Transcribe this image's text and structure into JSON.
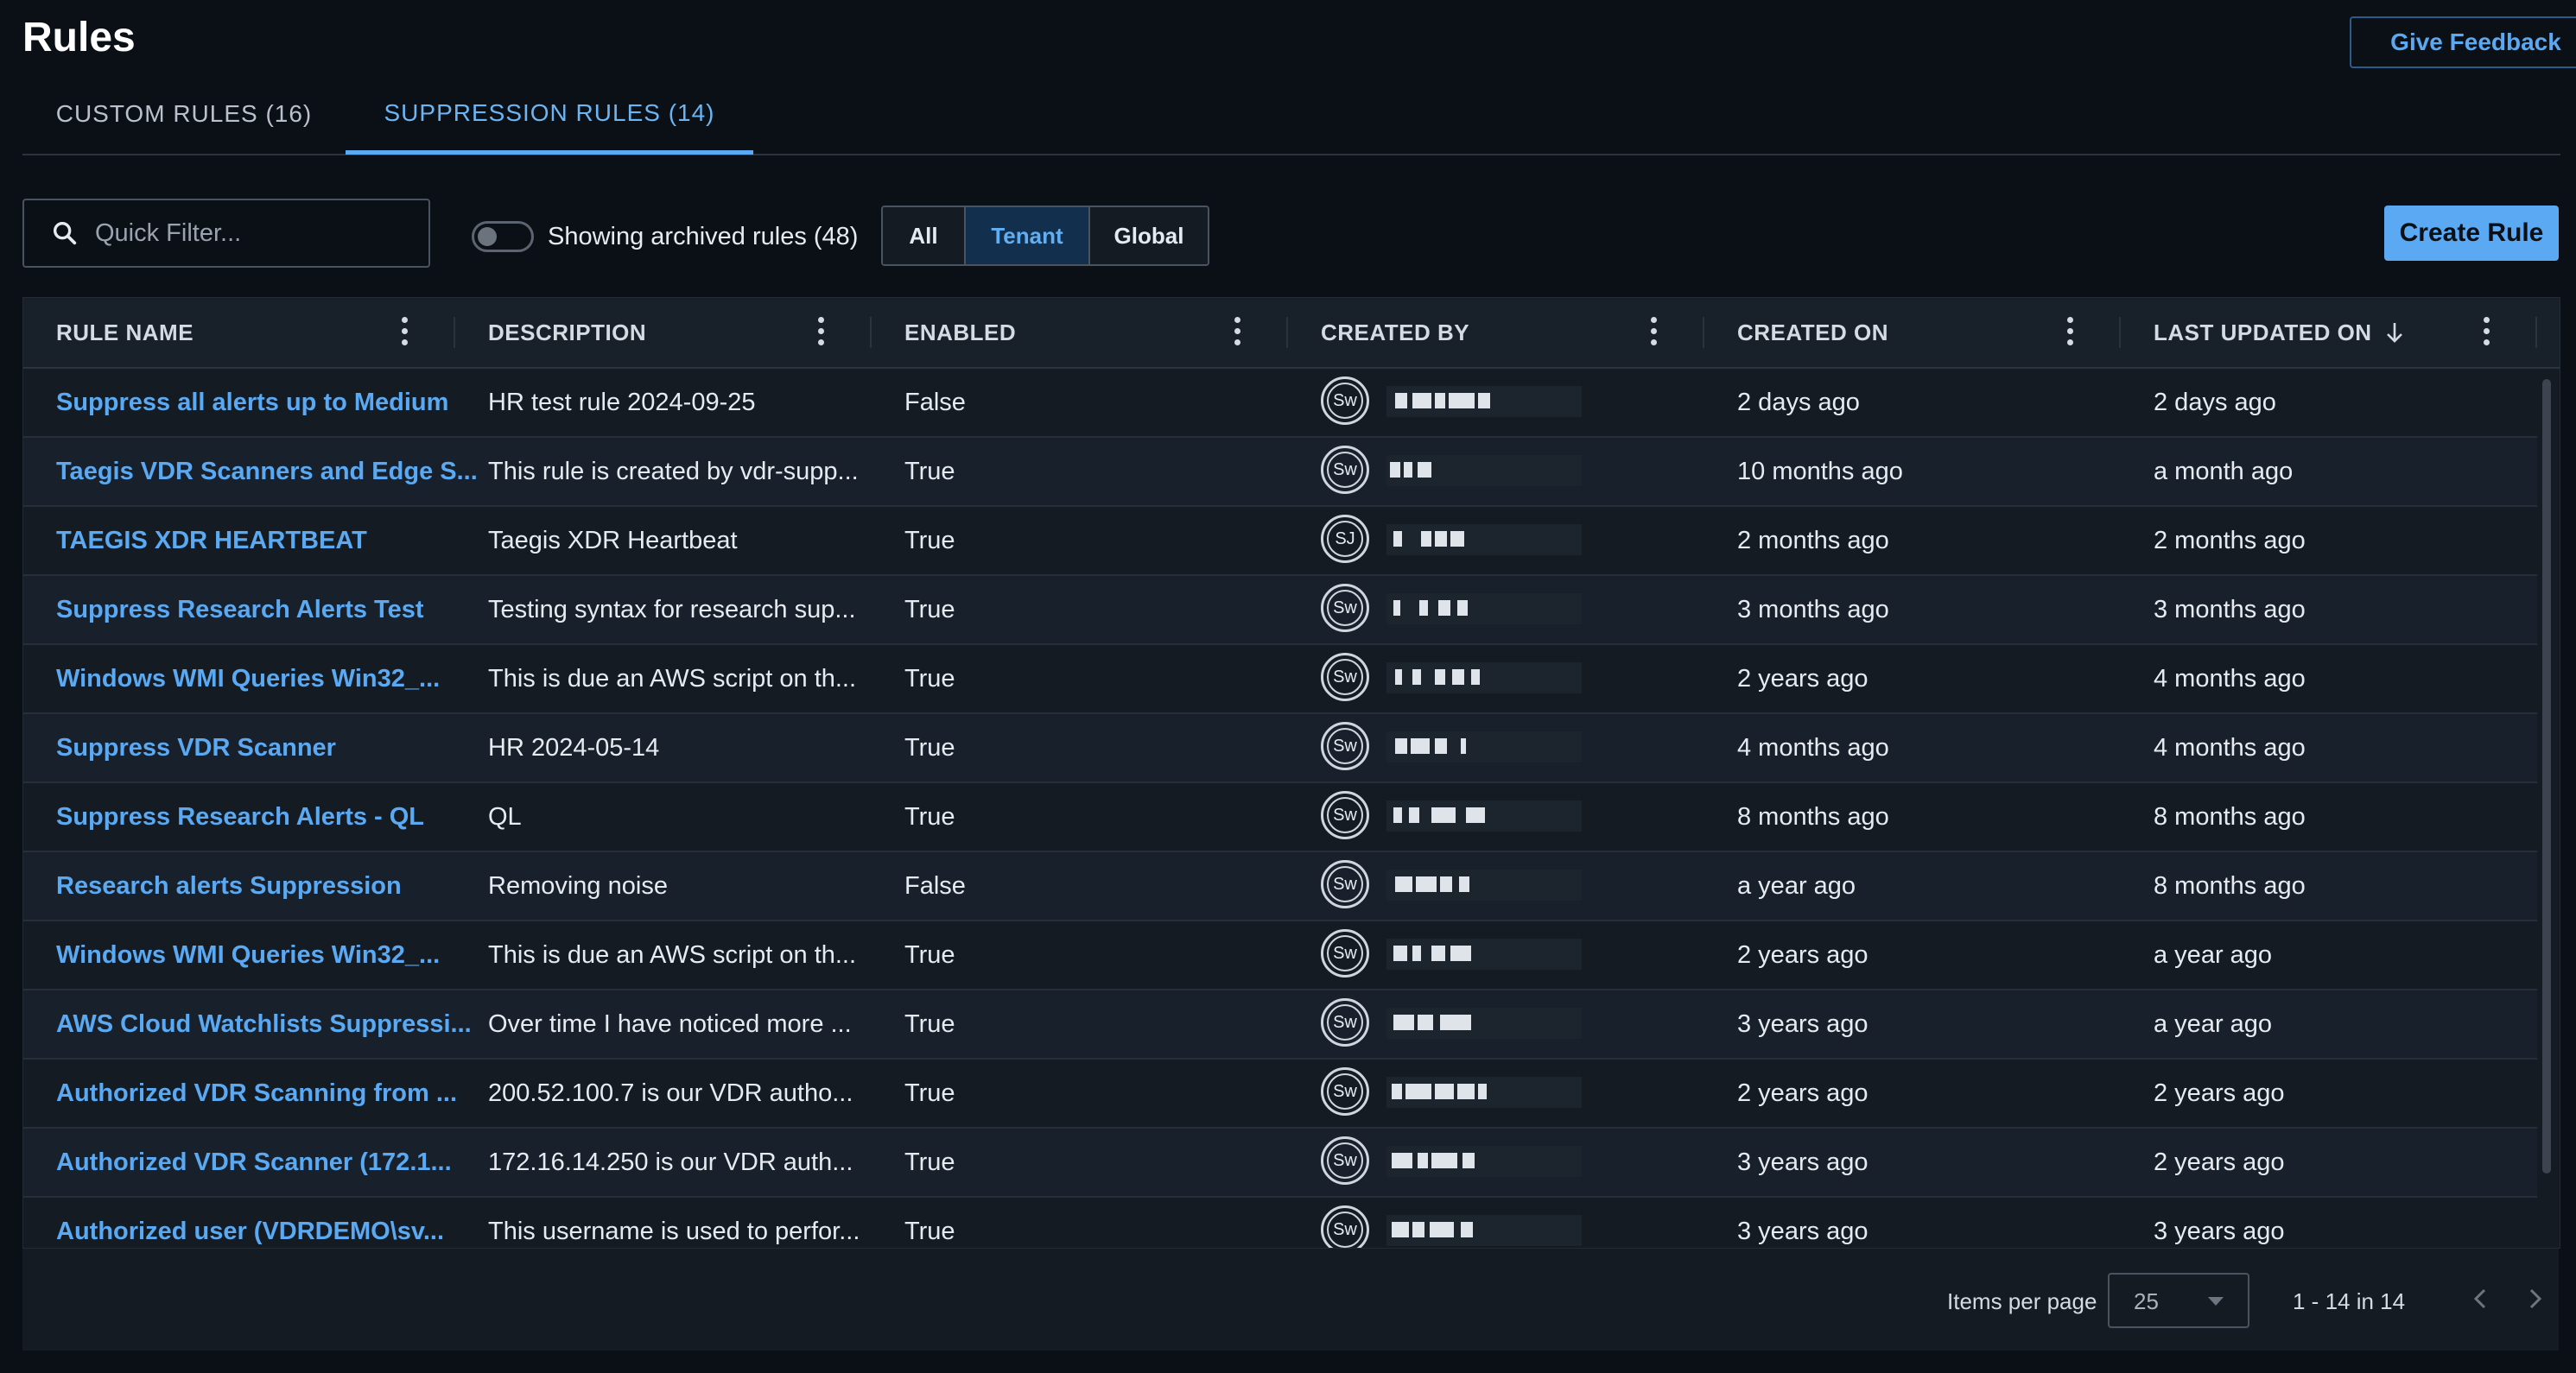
{
  "page": {
    "title": "Rules",
    "feedback_label": "Give Feedback"
  },
  "tabs": [
    {
      "label": "CUSTOM RULES (16)",
      "active": false
    },
    {
      "label": "SUPPRESSION RULES (14)",
      "active": true
    }
  ],
  "toolbar": {
    "search_placeholder": "Quick Filter...",
    "archived_toggle_label": "Showing archived rules (48)",
    "archived_toggle_on": false,
    "filter_options": [
      "All",
      "Tenant",
      "Global"
    ],
    "filter_selected": "Tenant",
    "create_label": "Create Rule"
  },
  "table": {
    "columns": [
      "RULE NAME",
      "DESCRIPTION",
      "ENABLED",
      "CREATED BY",
      "CREATED ON",
      "LAST UPDATED ON"
    ],
    "sorted_column": "LAST UPDATED ON",
    "sort_direction": "descending",
    "rows": [
      {
        "name": "Suppress all alerts up to Medium",
        "description": "HR test rule 2024-09-25",
        "enabled": "False",
        "avatar": "Sw",
        "created_on": "2 days ago",
        "updated_on": "2 days ago"
      },
      {
        "name": "Taegis VDR Scanners and Edge S...",
        "description": "This rule is created by vdr-supp...",
        "enabled": "True",
        "avatar": "Sw",
        "created_on": "10 months ago",
        "updated_on": "a month ago"
      },
      {
        "name": "TAEGIS XDR HEARTBEAT",
        "description": "Taegis XDR Heartbeat",
        "enabled": "True",
        "avatar": "SJ",
        "created_on": "2 months ago",
        "updated_on": "2 months ago"
      },
      {
        "name": "Suppress Research Alerts Test",
        "description": "Testing syntax for research sup...",
        "enabled": "True",
        "avatar": "Sw",
        "created_on": "3 months ago",
        "updated_on": "3 months ago"
      },
      {
        "name": "Windows WMI Queries Win32_...",
        "description": "This is due an AWS script on th...",
        "enabled": "True",
        "avatar": "Sw",
        "created_on": "2 years ago",
        "updated_on": "4 months ago"
      },
      {
        "name": "Suppress VDR Scanner",
        "description": "HR 2024-05-14",
        "enabled": "True",
        "avatar": "Sw",
        "created_on": "4 months ago",
        "updated_on": "4 months ago"
      },
      {
        "name": "Suppress Research Alerts - QL",
        "description": "QL",
        "enabled": "True",
        "avatar": "Sw",
        "created_on": "8 months ago",
        "updated_on": "8 months ago"
      },
      {
        "name": "Research alerts Suppression",
        "description": "Removing noise",
        "enabled": "False",
        "avatar": "Sw",
        "created_on": "a year ago",
        "updated_on": "8 months ago"
      },
      {
        "name": "Windows WMI Queries Win32_...",
        "description": "This is due an AWS script on th...",
        "enabled": "True",
        "avatar": "Sw",
        "created_on": "2 years ago",
        "updated_on": "a year ago"
      },
      {
        "name": "AWS Cloud Watchlists Suppressi...",
        "description": "Over time I have noticed more ...",
        "enabled": "True",
        "avatar": "Sw",
        "created_on": "3 years ago",
        "updated_on": "a year ago"
      },
      {
        "name": "Authorized VDR Scanning from ...",
        "description": "200.52.100.7 is our VDR autho...",
        "enabled": "True",
        "avatar": "Sw",
        "created_on": "2 years ago",
        "updated_on": "2 years ago"
      },
      {
        "name": "Authorized VDR Scanner (172.1...",
        "description": "172.16.14.250 is our VDR auth...",
        "enabled": "True",
        "avatar": "Sw",
        "created_on": "3 years ago",
        "updated_on": "2 years ago"
      },
      {
        "name": "Authorized user (VDRDEMO\\sv...",
        "description": "This username is used to perfor...",
        "enabled": "True",
        "avatar": "Sw",
        "created_on": "3 years ago",
        "updated_on": "3 years ago"
      }
    ]
  },
  "pagination": {
    "items_per_page_label": "Items per page",
    "items_per_page": "25",
    "range": "1 - 14 in 14"
  },
  "colors": {
    "accent": "#5aa9f2",
    "background": "#0b1016",
    "surface": "#141b23"
  },
  "icons": [
    "search-icon",
    "sort-down-arrow-icon",
    "kebab-menu-icon",
    "chevron-left-icon",
    "chevron-right-icon",
    "caret-down-icon"
  ]
}
